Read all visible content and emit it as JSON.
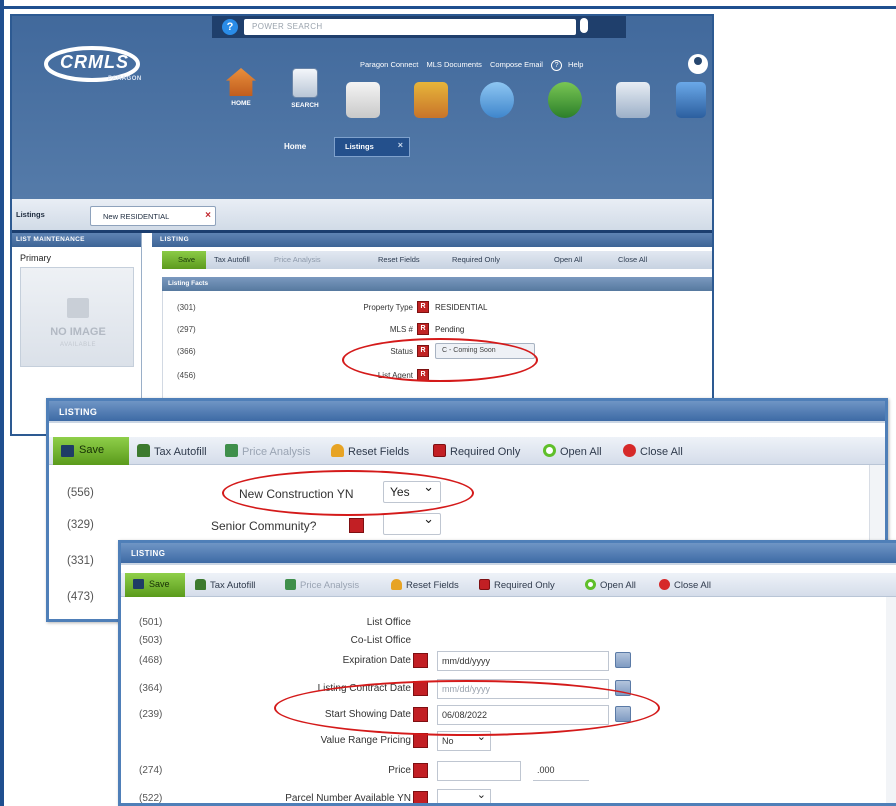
{
  "app": {
    "search_placeholder": "POWER SEARCH",
    "logo_text": "CRMLS",
    "logo_sub": "PARAGON",
    "top_links": [
      "Paragon Connect",
      "MLS Documents",
      "Compose Email",
      "Help"
    ],
    "nav": [
      {
        "label": "HOME",
        "icon": "home-icon"
      },
      {
        "label": "SEARCH",
        "icon": "search-doc-icon"
      }
    ],
    "tabs": {
      "home": "Home",
      "listings": "Listings"
    },
    "crumb_label": "Listings",
    "crumb_tab": "New RESIDENTIAL",
    "left_header": "LIST MAINTENANCE",
    "primary_label": "Primary",
    "no_image": "NO IMAGE",
    "no_image_sub": "AVAILABLE",
    "listing_header": "LISTING",
    "toolbar": [
      "Save",
      "Tax Autofill",
      "Price Analysis",
      "Reset Fields",
      "Required Only",
      "Open All",
      "Close All"
    ],
    "facts_header": "Listing Facts",
    "facts": [
      {
        "code": "(301)",
        "label": "Property Type",
        "value": "RESIDENTIAL"
      },
      {
        "code": "(297)",
        "label": "MLS #",
        "value": "Pending"
      },
      {
        "code": "(366)",
        "label": "Status",
        "value": "C - Coming Soon"
      },
      {
        "code": "(456)",
        "label": "List Agent",
        "value": ""
      }
    ]
  },
  "panel2": {
    "header": "LISTING",
    "toolbar": [
      "Save",
      "Tax Autofill",
      "Price Analysis",
      "Reset Fields",
      "Required Only",
      "Open All",
      "Close All"
    ],
    "rows": [
      {
        "code": "(556)",
        "label": "New Construction YN",
        "value": "Yes"
      },
      {
        "code": "(329)",
        "label": "Senior Community?",
        "value": ""
      },
      {
        "code": "(331)",
        "label": "",
        "value": ""
      },
      {
        "code": "(473)",
        "label": "",
        "value": ""
      }
    ]
  },
  "panel3": {
    "header": "LISTING",
    "toolbar": [
      "Save",
      "Tax Autofill",
      "Price Analysis",
      "Reset Fields",
      "Required Only",
      "Open All",
      "Close All"
    ],
    "rows": [
      {
        "code": "(501)",
        "label": "List Office",
        "value": ""
      },
      {
        "code": "(503)",
        "label": "Co-List Office",
        "value": ""
      },
      {
        "code": "(468)",
        "label": "Expiration Date",
        "value": "mm/dd/yyyy"
      },
      {
        "code": "(364)",
        "label": "Listing Contract Date",
        "value": "mm/dd/yyyy"
      },
      {
        "code": "(239)",
        "label": "Start Showing Date",
        "value": "06/08/2022"
      },
      {
        "code": "",
        "label": "Value Range Pricing",
        "value": "No"
      },
      {
        "code": "(274)",
        "label": "Price",
        "value": ".000"
      },
      {
        "code": "(522)",
        "label": "Parcel Number Available YN",
        "value": ""
      }
    ]
  },
  "colors": {
    "highlight_oval": "#d41a1a",
    "required": "#c21f24",
    "save_green": "#6aaa2a",
    "header_blue": "#3d6aa5"
  }
}
